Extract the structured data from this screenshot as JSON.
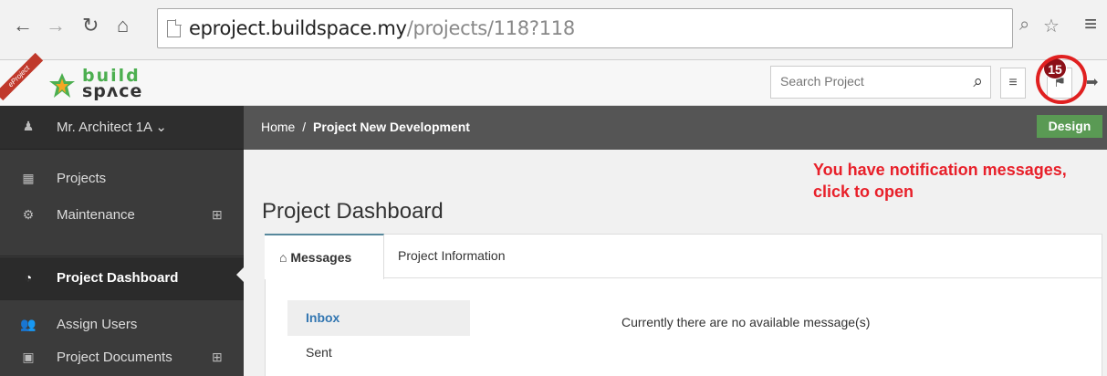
{
  "browser": {
    "url_host": "eproject.buildspace.my",
    "url_path": "/projects/118?118"
  },
  "header": {
    "ribbon_text": "eProject",
    "logo_line1": "build",
    "logo_line2": "spʌce",
    "search_placeholder": "Search Project",
    "notification_count": "15"
  },
  "sidebar": {
    "user": "Mr. Architect 1A",
    "items": [
      {
        "label": "Projects",
        "icon": "table-icon"
      },
      {
        "label": "Maintenance",
        "icon": "cogs-icon"
      },
      {
        "label": "Project Dashboard",
        "icon": "dashboard-icon"
      },
      {
        "label": "Assign Users",
        "icon": "users-icon"
      },
      {
        "label": "Project Documents",
        "icon": "word-doc-icon"
      }
    ]
  },
  "breadcrumb": {
    "home": "Home",
    "separator": "/",
    "current": "Project New Development",
    "status_badge": "Design"
  },
  "main": {
    "title": "Project Dashboard",
    "annotation": "You have notification messages,\nclick to open",
    "tabs": [
      {
        "label": "Messages"
      },
      {
        "label": "Project Information"
      }
    ],
    "folders": [
      {
        "label": "Inbox"
      },
      {
        "label": "Sent"
      }
    ],
    "empty_message": "Currently there are no available message(s)"
  },
  "colors": {
    "sidebar_bg": "#3b3b3b",
    "breadcrumb_bg": "#555555",
    "design_badge": "#5a9a54",
    "notification_badge": "#8b0f17",
    "annotation_red": "#e8202a",
    "link_blue": "#3276b1"
  }
}
